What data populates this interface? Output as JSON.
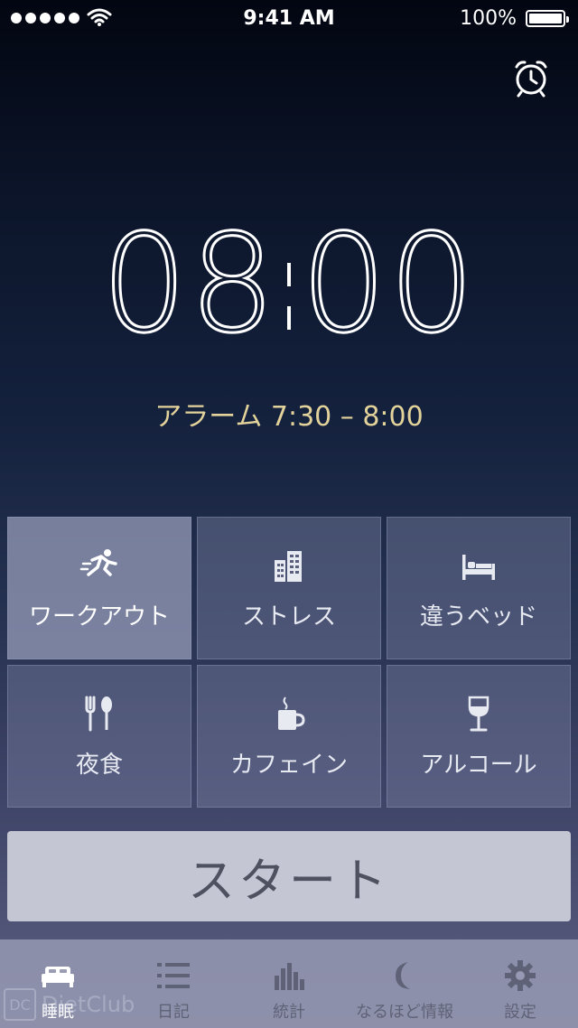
{
  "status_bar": {
    "time": "9:41 AM",
    "battery": "100%",
    "signal_icon": "signal-dots-icon",
    "wifi_icon": "wifi-icon",
    "battery_icon": "battery-icon"
  },
  "header": {
    "alarm_icon": "alarm-clock-icon"
  },
  "main": {
    "wake_time": "08:00",
    "wake_hours": "08",
    "wake_minutes": "00",
    "alarm_range": "アラーム 7:30 – 8:00"
  },
  "factors": [
    {
      "label": "ワークアウト",
      "icon": "running-icon",
      "selected": true
    },
    {
      "label": "ストレス",
      "icon": "buildings-icon",
      "selected": false
    },
    {
      "label": "違うベッド",
      "icon": "bed-icon",
      "selected": false
    },
    {
      "label": "夜食",
      "icon": "fork-spoon-icon",
      "selected": false
    },
    {
      "label": "カフェイン",
      "icon": "coffee-cup-icon",
      "selected": false
    },
    {
      "label": "アルコール",
      "icon": "wine-glass-icon",
      "selected": false
    }
  ],
  "start_button": {
    "label": "スタート"
  },
  "tabbar": {
    "tabs": [
      {
        "label": "睡眠",
        "icon": "bed-icon",
        "active": true
      },
      {
        "label": "日記",
        "icon": "list-icon",
        "active": false
      },
      {
        "label": "統計",
        "icon": "bar-chart-icon",
        "active": false
      },
      {
        "label": "なるほど情報",
        "icon": "moon-icon",
        "active": false
      },
      {
        "label": "設定",
        "icon": "gear-icon",
        "active": false
      }
    ]
  },
  "watermark": {
    "logo": "DC",
    "text": "DietClub"
  },
  "colors": {
    "accent_text": "#e3d39b",
    "tile": "#787ea0",
    "start_button": "#c4c6d4"
  }
}
